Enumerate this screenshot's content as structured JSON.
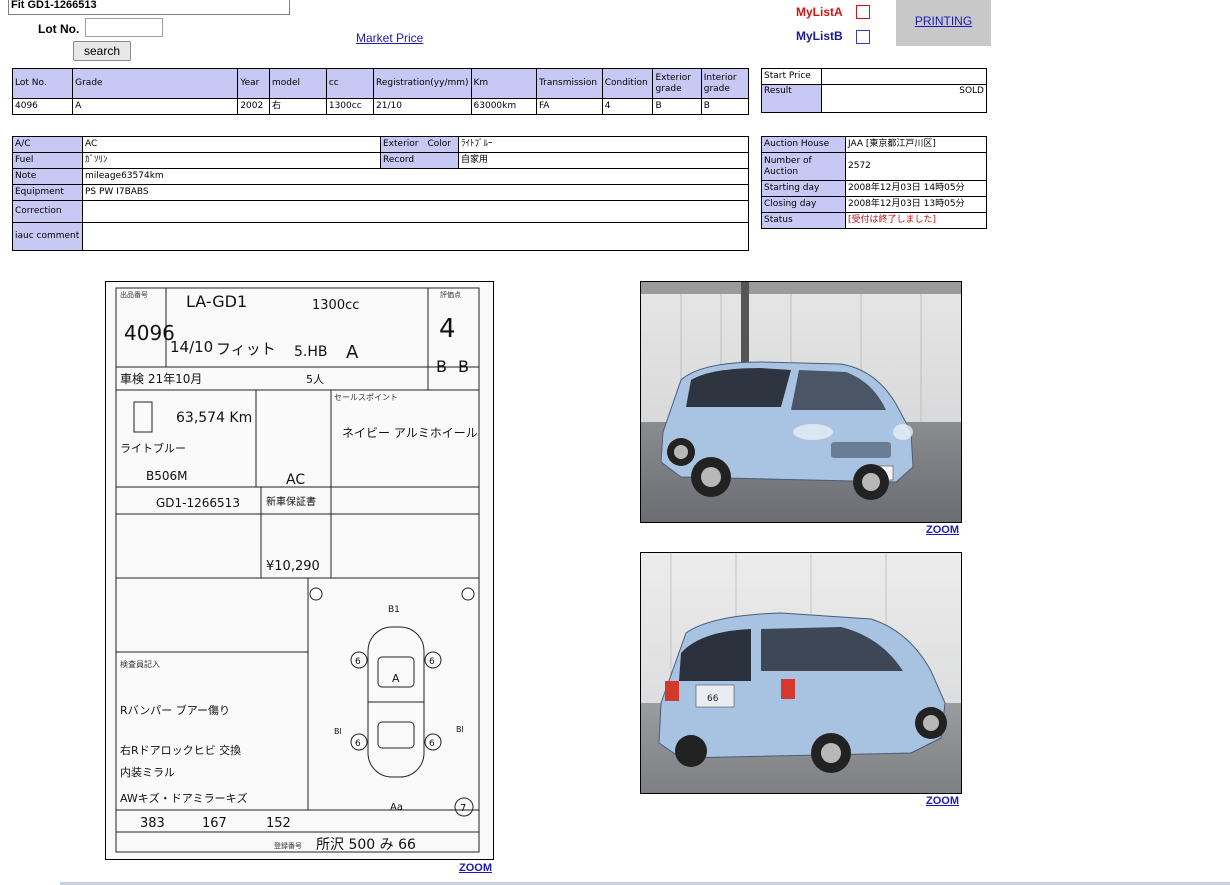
{
  "header": {
    "vehicle_title": "Fit GD1-1266513",
    "lot_label": "Lot No.",
    "lot_input_value": "",
    "search_label": "search",
    "market_price_label": "Market Price",
    "mylist_a_label": "MyListA",
    "mylist_b_label": "MyListB",
    "printing_label": "PRINTING"
  },
  "main_table": {
    "headers": [
      "Lot No.",
      "Grade",
      "Year",
      "model",
      "cc",
      "Registration(yy/mm)",
      "Km",
      "Transmission",
      "Condition",
      "Exterior grade",
      "Interior grade"
    ],
    "values": [
      "4096",
      "A",
      "2002",
      "右",
      "1300cc",
      "21/10",
      "63000km",
      "FA",
      "4",
      "B",
      "B"
    ]
  },
  "price_table": {
    "start_price_label": "Start Price",
    "start_price_value": "",
    "result_label": "Result",
    "result_value": "SOLD"
  },
  "info_table": {
    "ac_label": "A/C",
    "ac_value": "AC",
    "exterior_color_label": "Exterior　Color",
    "exterior_color_value": "ﾗｲﾄﾌﾞﾙｰ",
    "fuel_label": "Fuel",
    "fuel_value": "ｶﾞｿﾘﾝ",
    "record_label": "Record",
    "record_value": "自家用",
    "note_label": "Note",
    "note_value": "mileage63574km",
    "equipment_label": "Equipment",
    "equipment_value": "PS PW I7BABS",
    "correction_label": "Correction",
    "correction_value": "",
    "iauc_label": "iauc comment",
    "iauc_value": ""
  },
  "auction_table": {
    "house_label": "Auction House",
    "house_value": "JAA [東京都江戸川区]",
    "number_label": "Number of Auction",
    "number_value": "2572",
    "starting_label": "Starting day",
    "starting_value": "2008年12月03日 14時05分",
    "closing_label": "Closing day",
    "closing_value": "2008年12月03日 13時05分",
    "status_label": "Status",
    "status_value": "[受付は終了しました]"
  },
  "auction_sheet": {
    "lot": "4096",
    "model_code": "LA-GD1",
    "cc": "1300cc",
    "score": "4",
    "year": "14/10",
    "name": "フィット",
    "body": "5.HB",
    "grade": "A",
    "shaken": "車検 21年10月",
    "seats": "5人",
    "mileage": "63,574 Km",
    "color": "ライトブルー",
    "color_code": "B506M",
    "ac": "AC",
    "chassis": "GD1-1266513",
    "shin_hoshou": "新車保証書",
    "recycle": "¥10,290",
    "sales_point": "セールスポイント",
    "sales_comment": "ネイビー アルミホイール",
    "inspector_label": "検査員記入",
    "inspector_notes": [
      "Rバンパー ブアー傷り",
      "右Rドアロックヒビ 交換",
      "内装ミラル",
      "AWキズ・ドアミラーキズ"
    ],
    "dims": [
      "383",
      "167",
      "152"
    ],
    "plate": "所沢 500 み 66",
    "ext_grade": "B",
    "int_grade": "B",
    "diagram_marks": [
      "B1",
      "A",
      "6",
      "6",
      "6",
      "6",
      "Bl",
      "Bl",
      "Aa",
      "7"
    ],
    "registration_label": "登録番号"
  },
  "photos": {
    "front_alt": "Light blue Honda Fit front three-quarter view",
    "rear_alt": "Light blue Honda Fit rear three-quarter view",
    "rear_plate": "66"
  },
  "zoom_label": "ZOOM"
}
